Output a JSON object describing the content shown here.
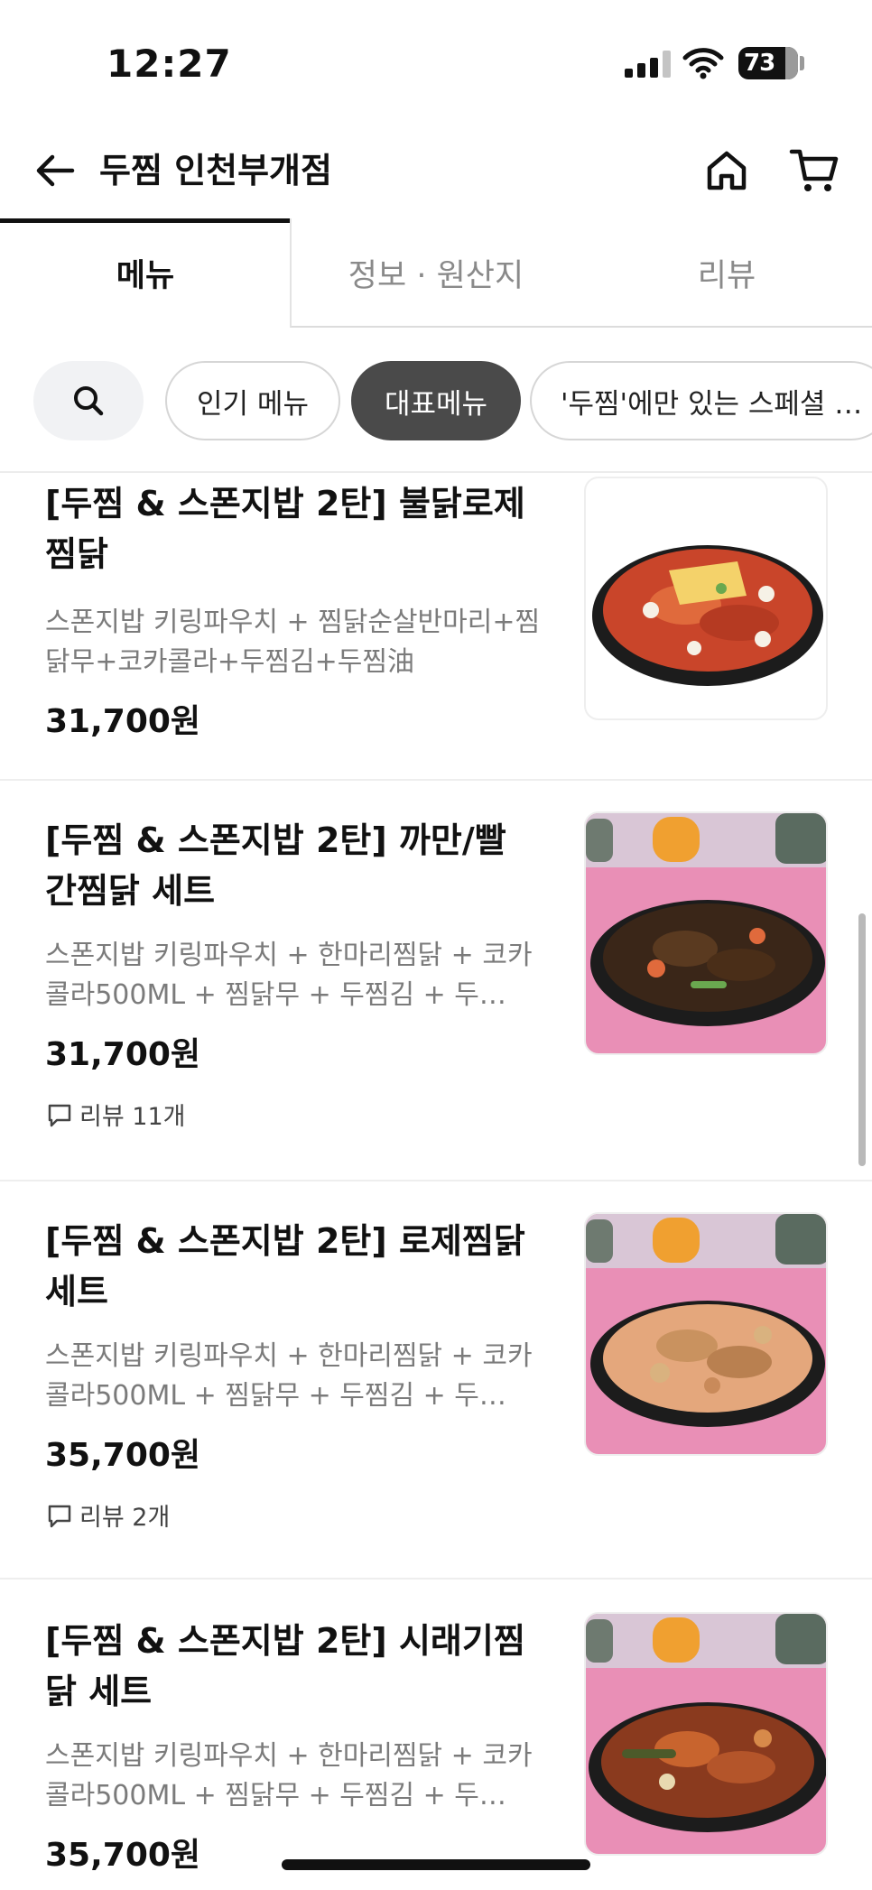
{
  "status_bar": {
    "time": "12:27",
    "battery": "73",
    "icons": [
      "signal-icon",
      "wifi-icon",
      "battery-icon"
    ]
  },
  "header": {
    "title": "두찜 인천부개점",
    "icons": [
      "back-arrow-icon",
      "home-icon",
      "cart-icon"
    ]
  },
  "tabs": [
    {
      "label": "메뉴",
      "active": true
    },
    {
      "label": "정보 · 원산지",
      "active": false
    },
    {
      "label": "리뷰",
      "active": false
    }
  ],
  "chips": [
    {
      "label": "인기 메뉴",
      "active": false
    },
    {
      "label": "대표메뉴",
      "active": true
    },
    {
      "label": "'두찜'에만 있는 스페셜 …",
      "active": false
    }
  ],
  "menu_items": [
    {
      "name_lines": [
        "[두찜 & 스폰지밥 2탄] 불닭로제",
        "찜닭"
      ],
      "desc_lines": [
        "스폰지밥 키링파우치 + 찜닭순살반마리+찜",
        "닭무+코카콜라+두찜김+두찜油"
      ],
      "price": "31,700원",
      "review": "",
      "image": "buldak-rose-jjimdak"
    },
    {
      "name_lines": [
        "[두찜 & 스폰지밥 2탄] 까만/빨",
        "간찜닭 세트"
      ],
      "desc_lines": [
        "스폰지밥 키링파우치 + 한마리찜닭 + 코카",
        "콜라500ML + 찜닭무 + 두찜김 + 두…"
      ],
      "price": "31,700원",
      "review": "리뷰 11개",
      "image": "black-jjimdak"
    },
    {
      "name_lines": [
        "[두찜 & 스폰지밥 2탄] 로제찜닭",
        "세트"
      ],
      "desc_lines": [
        "스폰지밥 키링파우치 + 한마리찜닭 + 코카",
        "콜라500ML + 찜닭무 + 두찜김 + 두…"
      ],
      "price": "35,700원",
      "review": "리뷰 2개",
      "image": "rose-jjimdak"
    },
    {
      "name_lines": [
        "[두찜 & 스폰지밥 2탄] 시래기찜",
        "닭 세트"
      ],
      "desc_lines": [
        "스폰지밥 키링파우치 + 한마리찜닭 + 코카",
        "콜라500ML + 찜닭무 + 두찜김 + 두…"
      ],
      "price": "35,700원",
      "review": "",
      "image": "siraegi-jjimdak"
    }
  ],
  "colors": {
    "active_chip": "#4a4a4a",
    "pink_backdrop": "#e98fb6",
    "divider": "#eeeeee"
  }
}
